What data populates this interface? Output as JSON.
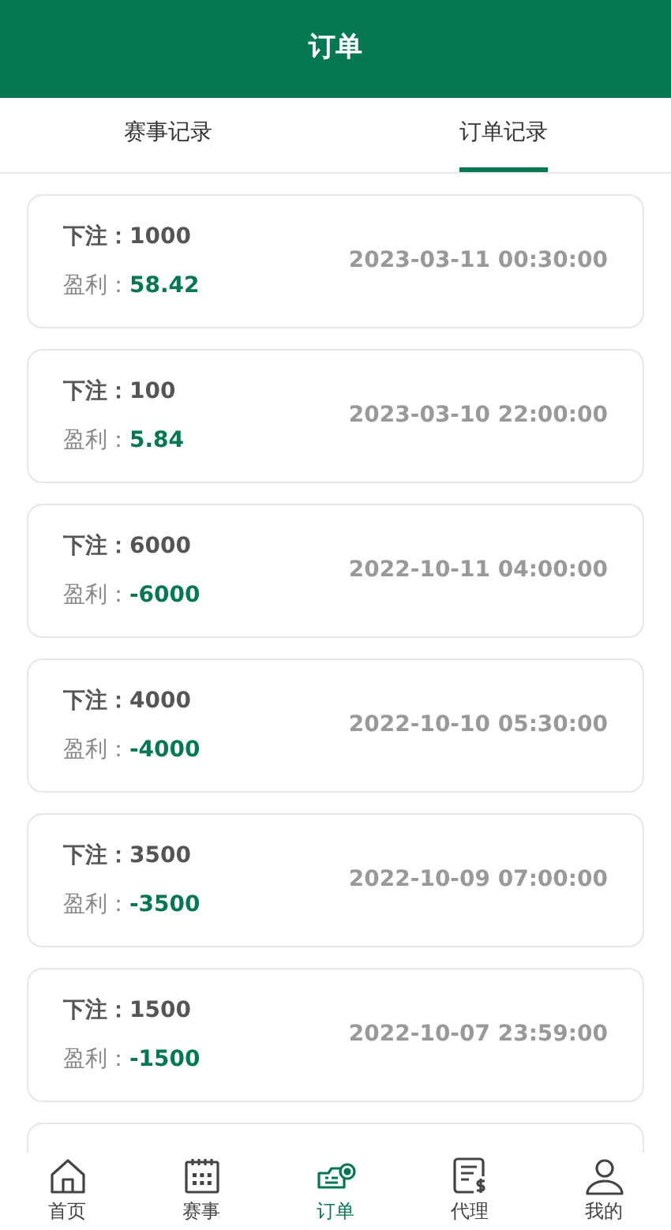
{
  "header": {
    "title": "订单"
  },
  "tabs": [
    {
      "label": "赛事记录",
      "selected": false
    },
    {
      "label": "订单记录",
      "selected": true
    }
  ],
  "orders": [
    {
      "bet_label": "下注：",
      "bet": "1000",
      "profit_label": "盈利：",
      "profit": "58.42",
      "time": "2023-03-11 00:30:00"
    },
    {
      "bet_label": "下注：",
      "bet": "100",
      "profit_label": "盈利：",
      "profit": "5.84",
      "time": "2023-03-10 22:00:00"
    },
    {
      "bet_label": "下注：",
      "bet": "6000",
      "profit_label": "盈利：",
      "profit": "-6000",
      "time": "2022-10-11 04:00:00"
    },
    {
      "bet_label": "下注：",
      "bet": "4000",
      "profit_label": "盈利：",
      "profit": "-4000",
      "time": "2022-10-10 05:30:00"
    },
    {
      "bet_label": "下注：",
      "bet": "3500",
      "profit_label": "盈利：",
      "profit": "-3500",
      "time": "2022-10-09 07:00:00"
    },
    {
      "bet_label": "下注：",
      "bet": "1500",
      "profit_label": "盈利：",
      "profit": "-1500",
      "time": "2022-10-07 23:59:00"
    }
  ],
  "bottom_nav": [
    {
      "label": "首页",
      "selected": false
    },
    {
      "label": "赛事",
      "selected": false
    },
    {
      "label": "订单",
      "selected": true
    },
    {
      "label": "代理",
      "selected": false
    },
    {
      "label": "我的",
      "selected": false
    }
  ]
}
